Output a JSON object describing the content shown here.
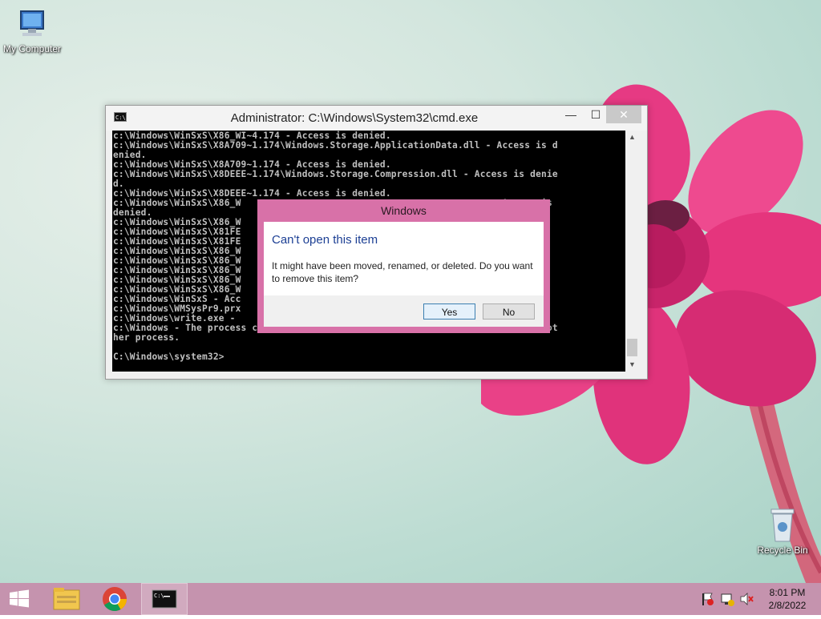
{
  "desktop": {
    "icons": [
      {
        "label": "My Computer"
      },
      {
        "label": "Recycle Bin"
      }
    ]
  },
  "cmd": {
    "title": "Administrator: C:\\Windows\\System32\\cmd.exe",
    "buttons": {
      "minimize": "—",
      "maximize": "☐",
      "close": "✕"
    },
    "lines": [
      "c:\\Windows\\WinSxS\\X86_WI~4.174 - Access is denied.",
      "c:\\Windows\\WinSxS\\X8A709~1.174\\Windows.Storage.ApplicationData.dll - Access is d",
      "enied.",
      "c:\\Windows\\WinSxS\\X8A709~1.174 - Access is denied.",
      "c:\\Windows\\WinSxS\\X8DEEE~1.174\\Windows.Storage.Compression.dll - Access is denie",
      "d.",
      "c:\\Windows\\WinSxS\\X8DEEE~1.174 - Access is denied.",
      "c:\\Windows\\WinSxS\\X86_W                                             - Access is",
      "denied.",
      "c:\\Windows\\WinSxS\\X86_W",
      "c:\\Windows\\WinSxS\\X81FE                                             d.",
      "c:\\Windows\\WinSxS\\X81FE                                             ed.",
      "c:\\Windows\\WinSxS\\X86_W                                             ed.",
      "c:\\Windows\\WinSxS\\X86_W",
      "c:\\Windows\\WinSxS\\X86_W                                             denied.",
      "c:\\Windows\\WinSxS\\X86_W",
      "c:\\Windows\\WinSxS\\X86_W",
      "c:\\Windows\\WinSxS - Acc",
      "c:\\Windows\\WMSysPr9.prx",
      "c:\\Windows\\write.exe -",
      "c:\\Windows - The process cannot access the file because it is being used by anot",
      "her process.",
      "",
      "C:\\Windows\\system32>"
    ]
  },
  "dialog": {
    "title": "Windows",
    "heading": "Can't open this item",
    "message": "It might have been moved, renamed, or deleted. Do you want to remove this item?",
    "yes_label": "Yes",
    "no_label": "No"
  },
  "taskbar": {
    "time": "8:01 PM",
    "date": "2/8/2022"
  },
  "colors": {
    "taskbar": "#c593ae",
    "dialog_frame": "#d871a8",
    "dialog_heading": "#1c3f94"
  }
}
